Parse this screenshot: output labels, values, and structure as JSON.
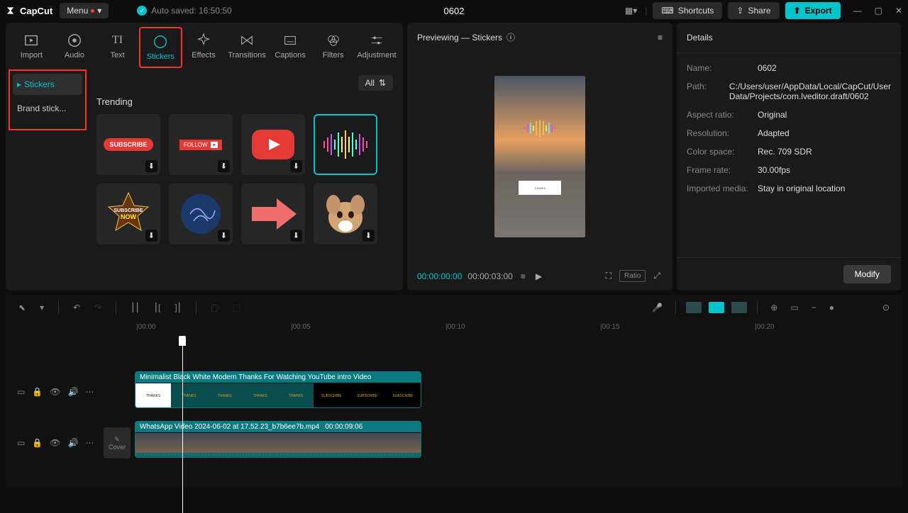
{
  "app": {
    "name": "CapCut",
    "menu": "Menu",
    "autosave": "Auto saved: 16:50:50",
    "title": "0602"
  },
  "titlebar_buttons": {
    "shortcuts": "Shortcuts",
    "share": "Share",
    "export": "Export"
  },
  "top_tabs": [
    {
      "label": "Import"
    },
    {
      "label": "Audio"
    },
    {
      "label": "Text"
    },
    {
      "label": "Stickers"
    },
    {
      "label": "Effects"
    },
    {
      "label": "Transitions"
    },
    {
      "label": "Captions"
    },
    {
      "label": "Filters"
    },
    {
      "label": "Adjustment"
    }
  ],
  "sidebar": {
    "items": [
      {
        "label": "Stickers"
      },
      {
        "label": "Brand stick..."
      }
    ],
    "all": "All",
    "section": "Trending"
  },
  "stickers": [
    {
      "name": "subscribe-red"
    },
    {
      "name": "follow-plus"
    },
    {
      "name": "youtube-play"
    },
    {
      "name": "audio-wave"
    },
    {
      "name": "subscribe-star"
    },
    {
      "name": "electric-orb"
    },
    {
      "name": "red-arrow"
    },
    {
      "name": "dog-head"
    }
  ],
  "preview": {
    "title": "Previewing — Stickers",
    "time_current": "00:00:00:00",
    "time_total": "00:00:03:00",
    "ratio": "Ratio"
  },
  "details": {
    "header": "Details",
    "rows": [
      {
        "label": "Name:",
        "value": "0602"
      },
      {
        "label": "Path:",
        "value": "C:/Users/user/AppData/Local/CapCut/User Data/Projects/com.lveditor.draft/0602"
      },
      {
        "label": "Aspect ratio:",
        "value": "Original"
      },
      {
        "label": "Resolution:",
        "value": "Adapted"
      },
      {
        "label": "Color space:",
        "value": "Rec. 709 SDR"
      },
      {
        "label": "Frame rate:",
        "value": "30.00fps"
      },
      {
        "label": "Imported media:",
        "value": "Stay in original location"
      }
    ],
    "modify": "Modify"
  },
  "ruler": [
    "|00:00",
    "|00:05",
    "|00:10",
    "|00:15",
    "|00:20"
  ],
  "clips": {
    "clip1_label": "Minimalist Black White Modern Thanks For Watching YouTube intro Video",
    "clip2_label": "WhatsApp Video 2024-06-02 at 17.52.23_b7b6ee7b.mp4",
    "clip2_duration": "00:00:09:06"
  },
  "cover": "Cover"
}
